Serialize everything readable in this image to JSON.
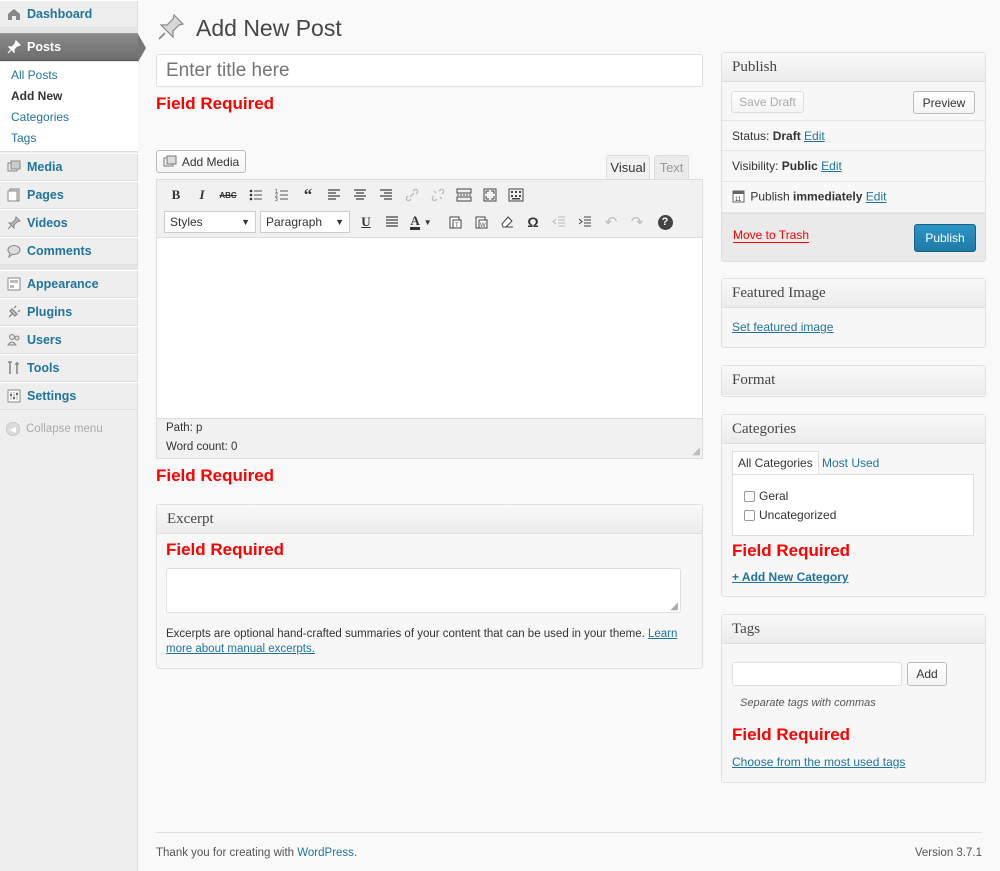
{
  "sidebar": {
    "dashboard": "Dashboard",
    "posts": "Posts",
    "sub": [
      "All Posts",
      "Add New",
      "Categories",
      "Tags"
    ],
    "media": "Media",
    "pages": "Pages",
    "videos": "Videos",
    "comments": "Comments",
    "appearance": "Appearance",
    "plugins": "Plugins",
    "users": "Users",
    "tools": "Tools",
    "settings": "Settings",
    "collapse": "Collapse menu"
  },
  "page_title": "Add New Post",
  "title_field": {
    "placeholder": "Enter title here"
  },
  "errors": {
    "field_required": "Field Required"
  },
  "editor": {
    "add_media": "Add Media",
    "tab_visual": "Visual",
    "tab_text": "Text",
    "styles": "Styles",
    "paragraph": "Paragraph",
    "path": "Path: p",
    "word_count": "Word count: 0"
  },
  "excerpt": {
    "title": "Excerpt",
    "help_text": "Excerpts are optional hand-crafted summaries of your content that can be used in your theme. ",
    "help_link": "Learn more about manual excerpts."
  },
  "publish": {
    "title": "Publish",
    "save_draft": "Save Draft",
    "preview": "Preview",
    "status_label": "Status: ",
    "status_value": "Draft",
    "visibility_label": "Visibility: ",
    "visibility_value": "Public",
    "publish_label": "Publish ",
    "publish_value": "immediately",
    "edit": "Edit",
    "move_to_trash": "Move to Trash",
    "publish_button": "Publish"
  },
  "featured_image": {
    "title": "Featured Image",
    "link": "Set featured image"
  },
  "format": {
    "title": "Format"
  },
  "categories": {
    "title": "Categories",
    "tab_all": "All Categories",
    "tab_most_used": "Most Used",
    "items": [
      "Geral",
      "Uncategorized"
    ],
    "add_new": "+ Add New Category"
  },
  "tags": {
    "title": "Tags",
    "add_button": "Add",
    "hint": "Separate tags with commas",
    "choose_link": "Choose from the most used tags"
  },
  "footer": {
    "thanks": "Thank you for creating with ",
    "wp_link": "WordPress",
    "period": ".",
    "version": "Version 3.7.1"
  },
  "colors": {
    "link": "#21759b",
    "error": "#ff0000",
    "primary_button": "#2386b7",
    "trash": "#ff0000"
  }
}
